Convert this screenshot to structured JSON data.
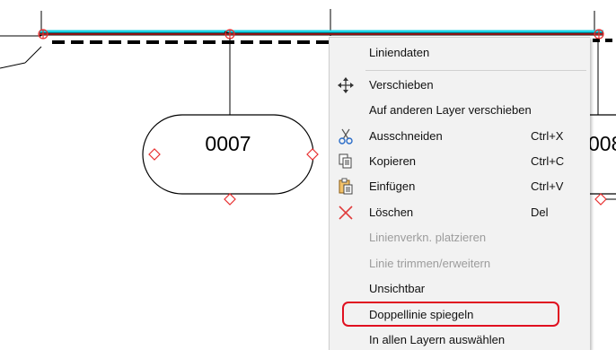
{
  "canvas": {
    "node_label_left": "0007",
    "node_label_right": "008"
  },
  "context_menu": {
    "items": [
      {
        "label": "Liniendaten",
        "shortcut": "",
        "icon": "",
        "enabled": true
      },
      {
        "label": "Verschieben",
        "shortcut": "",
        "icon": "move-arrows-icon",
        "enabled": true
      },
      {
        "label": "Auf anderen Layer verschieben",
        "shortcut": "",
        "icon": "",
        "enabled": true
      },
      {
        "label": "Ausschneiden",
        "shortcut": "Ctrl+X",
        "icon": "scissors-icon",
        "enabled": true
      },
      {
        "label": "Kopieren",
        "shortcut": "Ctrl+C",
        "icon": "copy-icon",
        "enabled": true
      },
      {
        "label": "Einfügen",
        "shortcut": "Ctrl+V",
        "icon": "paste-icon",
        "enabled": true
      },
      {
        "label": "Löschen",
        "shortcut": "Del",
        "icon": "delete-x-icon",
        "enabled": true
      },
      {
        "label": "Linienverkn. platzieren",
        "shortcut": "",
        "icon": "",
        "enabled": false
      },
      {
        "label": "Linie trimmen/erweitern",
        "shortcut": "",
        "icon": "",
        "enabled": false
      },
      {
        "label": "Unsichtbar",
        "shortcut": "",
        "icon": "",
        "enabled": true
      },
      {
        "label": "Doppellinie spiegeln",
        "shortcut": "",
        "icon": "",
        "enabled": true,
        "highlighted": true
      },
      {
        "label": "In allen Layern auswählen",
        "shortcut": "",
        "icon": "",
        "enabled": true
      }
    ]
  },
  "colors": {
    "highlight_outline": "#e01020",
    "selection_cyan": "#19d3e6",
    "selection_red": "#e02020",
    "node_marker_red": "#e83030",
    "menu_background": "#f2f2f2",
    "disabled_text": "#9c9c9c"
  }
}
